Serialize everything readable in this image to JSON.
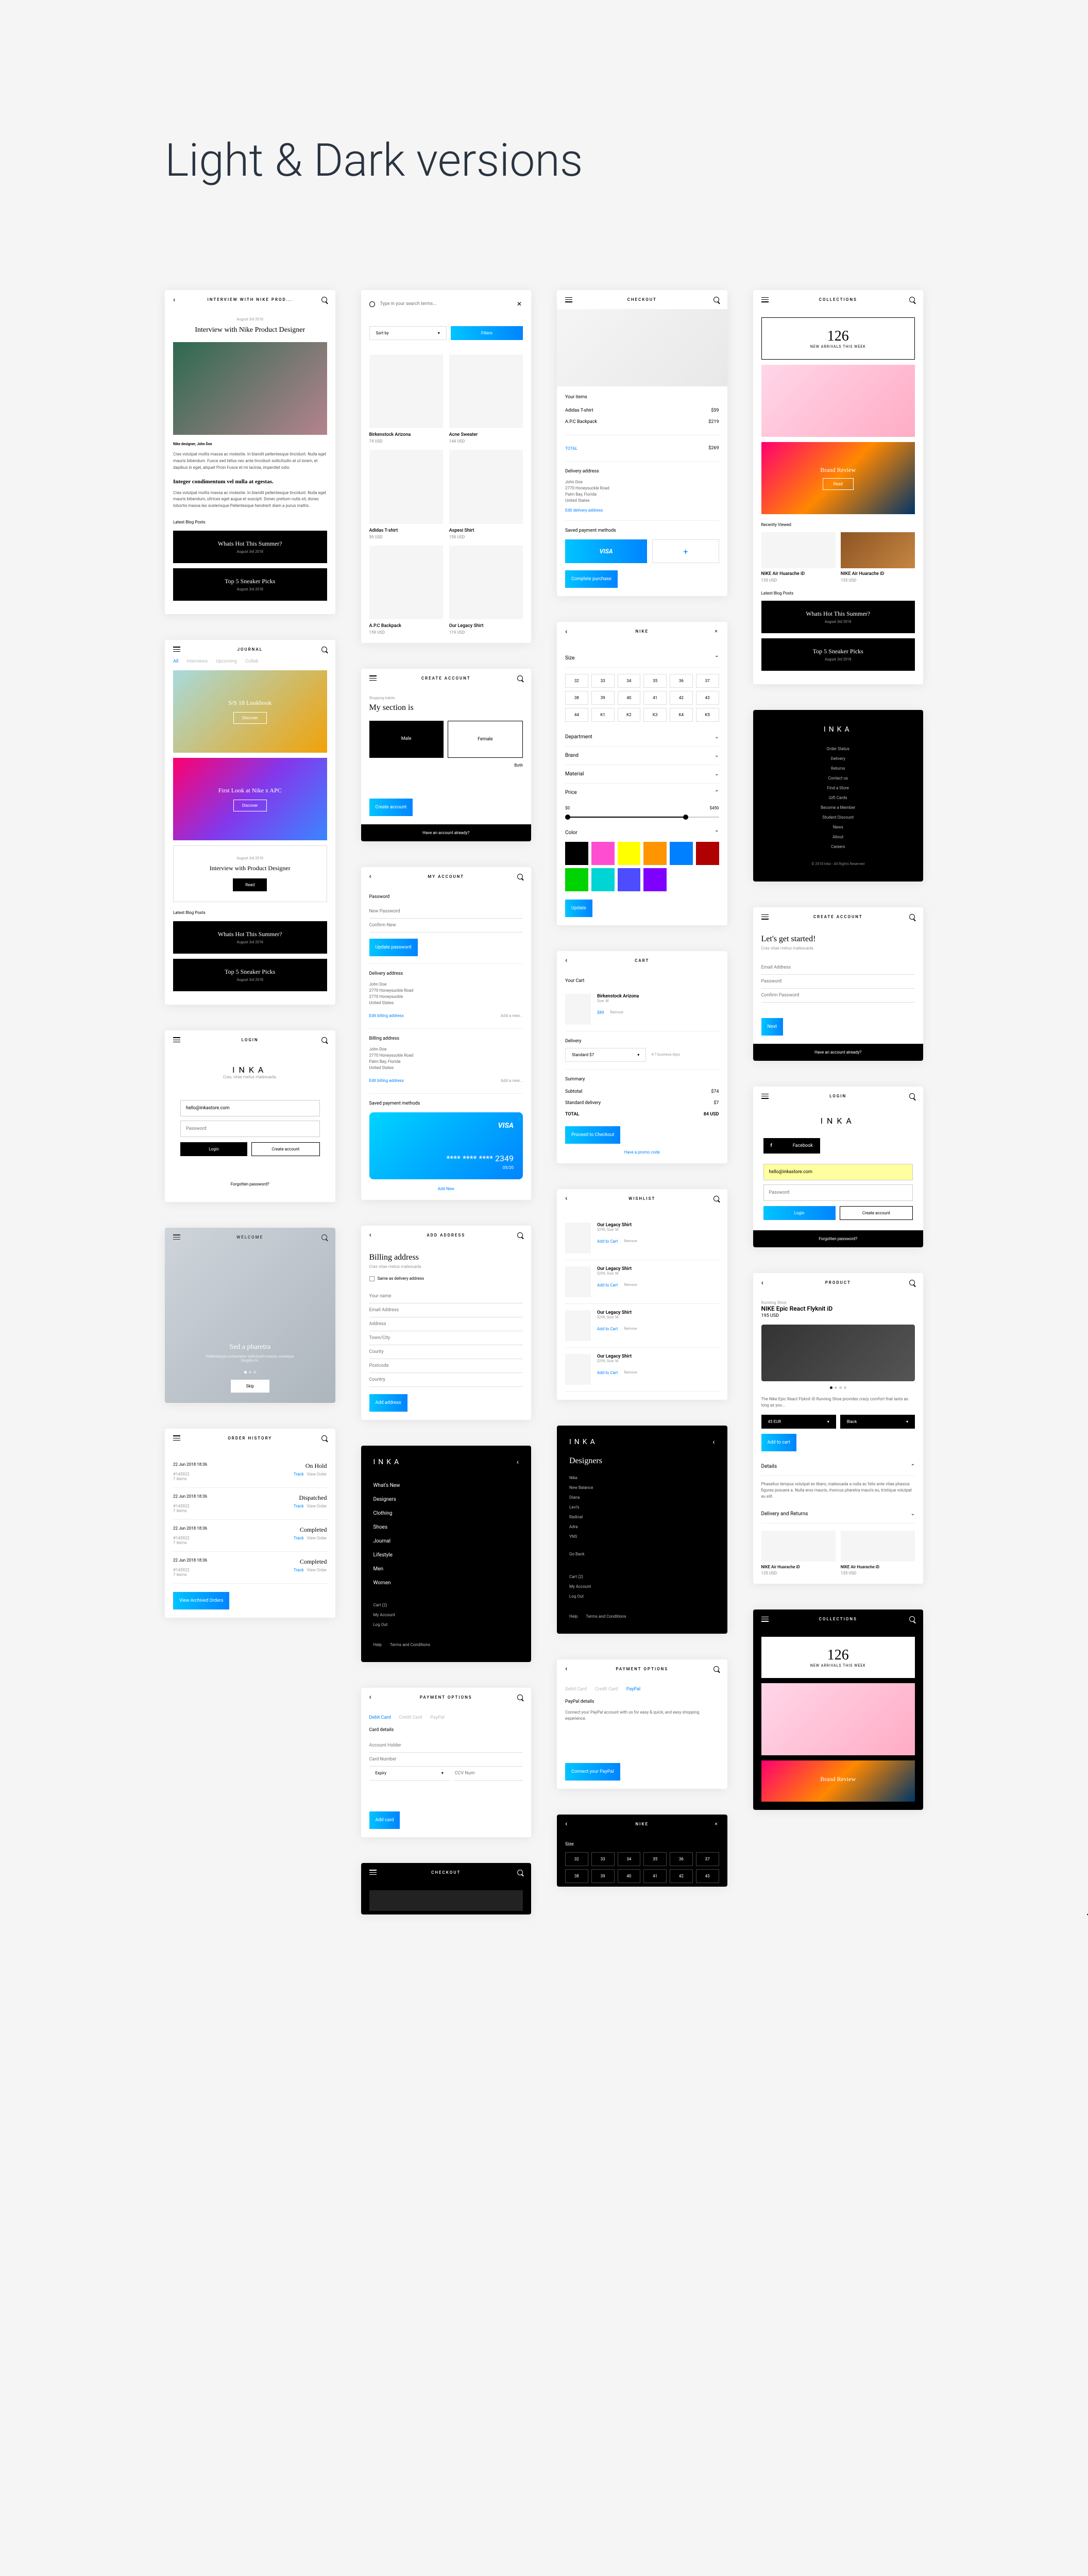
{
  "main_title": "Light & Dark versions",
  "brand": "INKA",
  "screens": {
    "interview": {
      "header": "INTERVIEW WITH NIKE PROD...",
      "date": "August 3rd 2018",
      "title": "Interview with Nike Product Designer",
      "author": "Nike designer, John Doe",
      "body1": "Cras volutpat mollis massa ac molestie. In blandit pellentesque tincidunt. Nulla eget mauris bibendum. Fusce sed tellus nec ante tincidunt sollicitudin at ut lorem, et dapibus in eget, aliquet Proin Fusce et mi lacinia, imperdiet odio.",
      "heading2": "Integer condimentum vel nulla at egestas.",
      "body2": "Cras volutpat mollis massa ac molestie. In blandit pellentesque tincidunt. Nulla eget mauris bibendum, ultrices eget augue et suscipit. Donec pretium nulla sit, donec lobortis massa leo scelerisque Pellentesque hendrerit diam a purus mattis.",
      "latest_label": "Latest Blog Posts"
    },
    "blog_posts": [
      {
        "title": "Whats Hot This Summer?",
        "date": "August 3rd 2018"
      },
      {
        "title": "Top 5 Sneaker Picks",
        "date": "August 3rd 2018"
      }
    ],
    "journal": {
      "header": "JOURNAL",
      "tabs": [
        "All",
        "Interviews",
        "Upcoming",
        "Collab"
      ],
      "card1": {
        "title": "S/S 18 Lookbook",
        "btn": "Discover"
      },
      "card2": {
        "title": "First Look at Nike x APC",
        "btn": "Discover"
      },
      "card3": {
        "date": "August 3rd 2018",
        "title": "Interview with Product Designer",
        "btn": "Read"
      }
    },
    "login": {
      "header": "LOGIN",
      "tagline": "Cras, vitae metus malesuada.",
      "email": "hello@inkastore.com",
      "pwd_ph": "Password",
      "login_btn": "Login",
      "create_btn": "Create account",
      "forgot": "Forgotten password?",
      "fb": "Facebook"
    },
    "welcome": {
      "header": "WELCOME",
      "title": "Sed a pharetra",
      "sub": "Pellentesque consectetur sollicitudin massa, consequa fringilla mi.",
      "btn": "Skip"
    },
    "order_history": {
      "header": "ORDER HISTORY",
      "orders": [
        {
          "date": "22 Jun 2018 18:36",
          "id": "#145922",
          "items": "7 items",
          "status": "On Hold",
          "track": "Track",
          "view": "View Order"
        },
        {
          "date": "22 Jun 2018 18:36",
          "id": "#145922",
          "items": "7 items",
          "status": "Dispatched",
          "track": "Track",
          "view": "View Order"
        },
        {
          "date": "22 Jun 2018 18:36",
          "id": "#145922",
          "items": "7 items",
          "status": "Completed",
          "track": "Track",
          "view": "View Order"
        },
        {
          "date": "22 Jun 2018 18:36",
          "id": "#145922",
          "items": "7 items",
          "status": "Completed",
          "track": "Track",
          "view": "View Order"
        }
      ],
      "view_archived": "View Archived Orders"
    },
    "search": {
      "placeholder": "Type in your search terms...",
      "sort": "Sort by",
      "filters": "Filters",
      "products": [
        {
          "name": "Birkenstock Arizona",
          "price": "74 USD"
        },
        {
          "name": "Acne Sweater",
          "price": "144 USD"
        },
        {
          "name": "Adidas T-shirt",
          "price": "59 USD"
        },
        {
          "name": "Aspesi Shirt",
          "price": "159 USD"
        },
        {
          "name": "A.P.C Backpack",
          "price": "159 USD"
        },
        {
          "name": "Our Legacy Shirt",
          "price": "119 USD"
        }
      ]
    },
    "create_account": {
      "header": "CREATE ACCOUNT",
      "sub": "Shopping habits",
      "title": "My section is",
      "male": "Male",
      "female": "Female",
      "both": "Both",
      "create": "Create account",
      "have": "Have an account already?"
    },
    "my_account": {
      "header": "MY ACCOUNT",
      "pwd": "Password",
      "new_pwd": "New Password",
      "confirm": "Confirm New",
      "update_pwd": "Update password",
      "delivery": "Delivery address",
      "billing": "Billing address",
      "name": "John Doe",
      "addr1": "2770 Honeysuckle Road",
      "addr2": "2770 Honeysuckle",
      "city": "Palm Bay, Florida",
      "country": "United States",
      "edit": "Edit billing address",
      "add_new": "Add a new...",
      "saved": "Saved payment methods",
      "card_last": "**** **** **** 2349",
      "card_exp": "05/20",
      "add_new_btn": "Add New"
    },
    "billing_addr": {
      "header": "ADD ADDRESS",
      "title": "Billing address",
      "sub": "Cras vitae metus malesuada.",
      "same": "Same as delivery address",
      "fields": [
        "Your name",
        "Email Address",
        "Address",
        "Town/City",
        "County",
        "Postcode",
        "Country"
      ],
      "btn": "Add address"
    },
    "nav_menu": {
      "general": [
        "What's New",
        "Designers",
        "Clothing",
        "Shoes",
        "Journal",
        "Lifestyle",
        "Men",
        "Women"
      ],
      "account": [
        "Cart (2)",
        "My Account",
        "Log Out"
      ],
      "footer": [
        "Help",
        "Terms and Conditions"
      ]
    },
    "nav_designers": {
      "title": "Designers",
      "items": [
        "Nike",
        "New Balance",
        "Diana",
        "Levi's",
        "Radical",
        "Adra",
        "YNS"
      ],
      "back": "Go Back"
    },
    "payment": {
      "header": "PAYMENT OPTIONS",
      "tabs": [
        "Debit Card",
        "Credit Card",
        "PayPal"
      ],
      "card_details": "Card details",
      "acc_holder": "Account Holder",
      "card_num": "Card Number",
      "expiry": "Expiry",
      "ccv": "CCV Num",
      "add_card": "Add card",
      "paypal_title": "PayPal details",
      "paypal_desc": "Connect your PayPal account with us for easy & quick, and easy shopping experience.",
      "connect": "Connect your PayPal"
    },
    "checkout": {
      "header": "CHECKOUT",
      "your_items": "Your items",
      "items": [
        {
          "name": "Adidas T-shirt",
          "price": "$59"
        },
        {
          "name": "A.P.C Backpack",
          "price": "$219"
        }
      ],
      "total_label": "TOTAL",
      "total": "$269",
      "delivery_label": "Delivery address",
      "edit_addr": "Edit delivery address",
      "saved_methods": "Saved payment methods",
      "visa": "VISA",
      "complete": "Complete purchase"
    },
    "nike_filter": {
      "header": "NIKE",
      "size": "Size",
      "sizes": [
        "32",
        "33",
        "34",
        "35",
        "36",
        "37",
        "38",
        "39",
        "40",
        "41",
        "42",
        "43",
        "44",
        "K1",
        "K2",
        "K3",
        "K4",
        "K5"
      ],
      "department": "Department",
      "brand": "Brand",
      "material": "Material",
      "price": "Price",
      "price_min": "$0",
      "price_max": "$450",
      "color": "Color",
      "colors": [
        "#000",
        "#ff4dd2",
        "#ffff00",
        "#ff9500",
        "#0080ff",
        "#b00000",
        "#00d400",
        "#00d4d4",
        "#4d4dff",
        "#8000ff"
      ],
      "update": "Update"
    },
    "cart": {
      "header": "CART",
      "your_cart": "Your Cart",
      "item": {
        "name": "Birkenstock Arizona",
        "size": "Size: M",
        "price": "$89",
        "remove": "Remove"
      },
      "delivery": "Delivery",
      "standard": "Standard $7",
      "days": "4-7 business days",
      "summary": "Summary",
      "subtotal": "Subtotal",
      "sub_val": "$74",
      "ship": "Standard delivery",
      "ship_val": "$7",
      "total": "TOTAL",
      "total_val": "84 USD",
      "proceed": "Proceed to Checkout",
      "promo": "Have a promo code"
    },
    "wishlist": {
      "header": "WISHLIST",
      "items": [
        {
          "name": "Our Legacy Shirt",
          "size": "$299, Size: M",
          "add": "Add to Cart",
          "remove": "Remove"
        },
        {
          "name": "Our Legacy Shirt",
          "size": "$299, Size: M",
          "add": "Add to Cart",
          "remove": "Remove"
        },
        {
          "name": "Our Legacy Shirt",
          "size": "$299, Size: M",
          "add": "Add to Cart",
          "remove": "Remove"
        },
        {
          "name": "Our Legacy Shirt",
          "size": "$299, Size: M",
          "add": "Add to Cart",
          "remove": "Remove"
        }
      ]
    },
    "collections": {
      "header": "COLLECTIONS",
      "number": "126",
      "sub": "NEW ARRIVALS THIS WEEK",
      "brand_review": "Brand Review",
      "read": "Read",
      "recently": "Recently Viewed",
      "prods": [
        {
          "name": "NIKE Air Huarache iD",
          "price": "135 USD"
        },
        {
          "name": "NIKE Air Huarache iD",
          "price": "135 USD"
        }
      ],
      "latest": "Latest Blog Posts"
    },
    "footer_dark": {
      "links": [
        "Order Status",
        "Delivery",
        "Returns",
        "Contact us",
        "Find a Store",
        "Gift Cards",
        "Become a Member",
        "Student Discount",
        "News",
        "About",
        "Careers"
      ],
      "copyright": "© 2018 Inka - All Rights Reserved"
    },
    "get_started": {
      "header": "CREATE ACCOUNT",
      "title": "Let's get started!",
      "sub": "Cras vitae metus malesuada.",
      "fields": [
        "Email Address",
        "Password",
        "Confirm Password"
      ],
      "next": "Next",
      "have": "Have an account already?"
    },
    "product": {
      "header": "PRODUCT",
      "cat": "Running Shoe",
      "name": "NIKE Epic React Flyknit iD",
      "price": "195 USD",
      "size_sel": "45 EUR",
      "color_sel": "Black",
      "add": "Add to cart",
      "details": "Details",
      "desc": "The Nike Epic React Flyknit iD Running Shoe provides crazy comfort that lasts as long as you...",
      "more": "Phasellus tempus volutpat ex libero, malesuada a nulla ac felis ante vitae phasius figures posuere a. Nulla eros mauris, rhoncus pharetra mauris eu, tristique volutpat eu elit.",
      "delivery_returns": "Delivery and Returns",
      "related": [
        {
          "name": "NIKE Air Huarache iD",
          "price": "135 USD"
        },
        {
          "name": "NIKE Air Huarache iD",
          "price": "135 USD"
        }
      ]
    }
  }
}
